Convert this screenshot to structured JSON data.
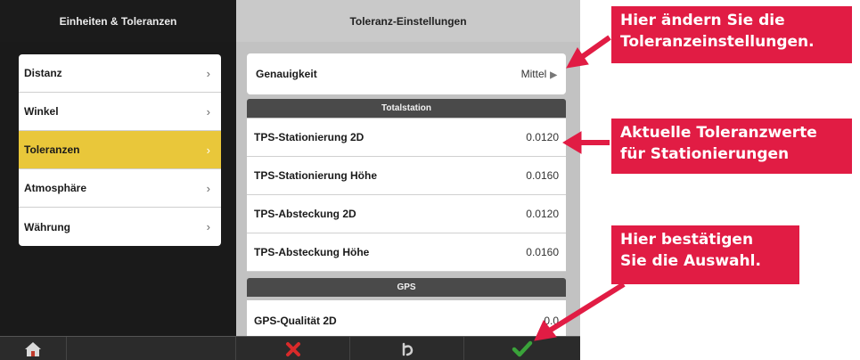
{
  "left": {
    "header": "Einheiten & Toleranzen",
    "items": [
      {
        "label": "Distanz"
      },
      {
        "label": "Winkel"
      },
      {
        "label": "Toleranzen"
      },
      {
        "label": "Atmosphäre"
      },
      {
        "label": "Währung"
      }
    ],
    "chevron": "›"
  },
  "right": {
    "header": "Toleranz-Einstellungen",
    "precision": {
      "label": "Genauigkeit",
      "value": "Mittel"
    },
    "sections": {
      "total": "Totalstation",
      "gps": "GPS"
    },
    "tolerances": [
      {
        "label": "TPS-Stationierung 2D",
        "value": "0.0120"
      },
      {
        "label": "TPS-Stationierung Höhe",
        "value": "0.0160"
      },
      {
        "label": "TPS-Absteckung 2D",
        "value": "0.0120"
      },
      {
        "label": "TPS-Absteckung Höhe",
        "value": "0.0160"
      }
    ],
    "gps_row": {
      "label": "GPS-Qualität 2D",
      "value": "0.0"
    }
  },
  "toolbar": {
    "home_icon": "home-icon",
    "cancel_icon": "x-icon",
    "undo_icon": "undo-icon",
    "confirm_icon": "checkmark-icon"
  },
  "callouts": {
    "change": "Hier ändern Sie die Toleranzeinstellungen.",
    "change_l1": "Hier ändern Sie die",
    "change_l2": "Toleranzeinstellungen.",
    "current_l1": "Aktuelle Toleranzwerte",
    "current_l2": "für Stationierungen",
    "confirm_l1": "Hier bestätigen",
    "confirm_l2": "Sie die Auswahl."
  },
  "colors": {
    "accent": "#e11c44",
    "active_item": "#e9c73a",
    "confirm": "#3aa33a",
    "cancel": "#d92a2a"
  }
}
